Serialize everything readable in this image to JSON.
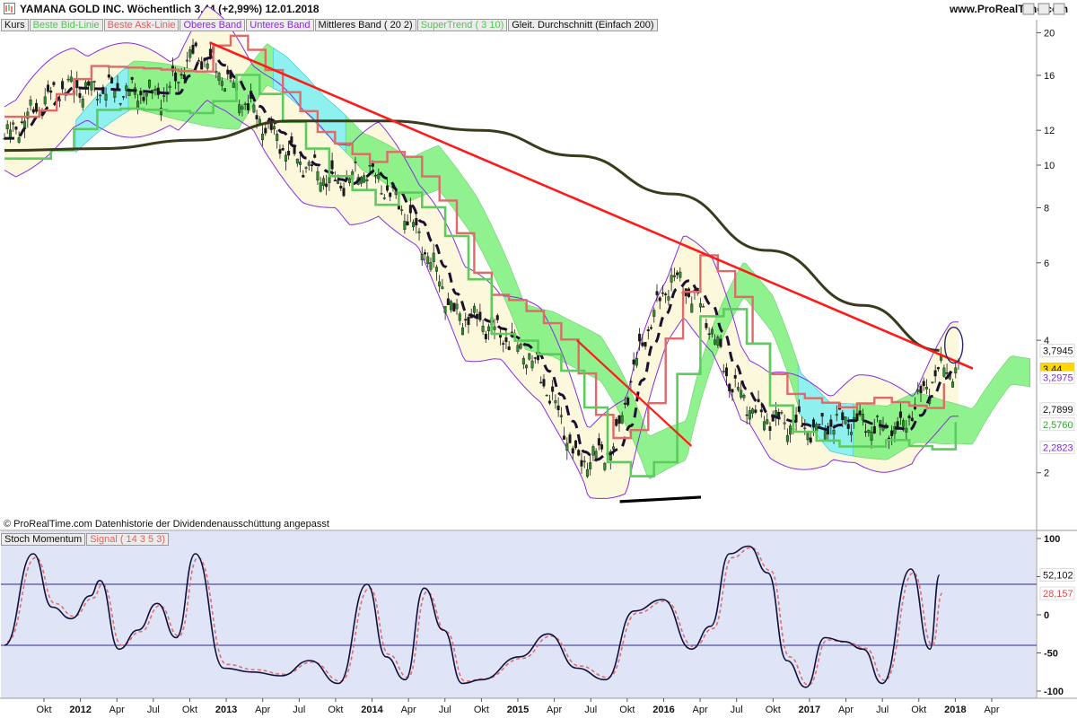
{
  "header": {
    "title": "YAMANA GOLD INC.   Wöchentlich   3,44 (+2,99%)   12.01.2018",
    "site": "www.ProRealTime.com"
  },
  "legend": [
    {
      "label": "Kurs",
      "color": "#111111"
    },
    {
      "label": "Beste Bid-Linie",
      "color": "#55c455"
    },
    {
      "label": "Beste Ask-Linie",
      "color": "#e06060"
    },
    {
      "label": "Oberes Band",
      "color": "#8a2be2"
    },
    {
      "label": "Unteres Band",
      "color": "#8a2be2"
    },
    {
      "label": "Mittleres Band ( 20 2)",
      "color": "#111111"
    },
    {
      "label": "SuperTrend ( 3 10)",
      "color": "#55c455"
    },
    {
      "label": "Gleit. Durchschnitt (Einfach 200)",
      "color": "#111111"
    }
  ],
  "footer": {
    "copyright": "© ProRealTime.com  Datenhistorie der Dividendenausschüttung angepasst"
  },
  "indicator": {
    "name": "Stoch Momentum",
    "signal": "Signal ( 14 3 5 3)"
  },
  "colors": {
    "trendline": "#ff1a1a",
    "sma200": "#3a3a1c",
    "bollinger": "#8a2be2",
    "ask": "#e06a6a",
    "supertrend": "#5ccc5c",
    "cloud_green": "#7cf07c",
    "cloud_cyan": "#8ff0f0"
  },
  "chart_data": [
    {
      "type": "line",
      "y_scale": "log",
      "ylim": [
        1.5,
        21
      ],
      "y_ticks": [
        2,
        4,
        6,
        8,
        10,
        12,
        16,
        20
      ],
      "x_tick_labels": [
        "Okt",
        "2012",
        "Apr",
        "Jul",
        "Okt",
        "2013",
        "Apr",
        "Jul",
        "Okt",
        "2014",
        "Apr",
        "Jul",
        "Okt",
        "2015",
        "Apr",
        "Jul",
        "Okt",
        "2016",
        "Apr",
        "Jul",
        "Okt",
        "2017",
        "Apr",
        "Jul",
        "Okt",
        "2018",
        "Apr"
      ],
      "last_values": [
        {
          "label": "3,7945",
          "name": "SMA 200",
          "y": 3.7945,
          "color": "#ffffff",
          "text": "#111111"
        },
        {
          "label": "3,44",
          "name": "Kurs",
          "y": 3.44,
          "color": "#ffd700",
          "text": "#111111"
        },
        {
          "label": "3,2975",
          "name": "Oberes Band",
          "y": 3.2975,
          "color": "#ffffff",
          "text": "#7a2be2"
        },
        {
          "label": "2,7899",
          "name": "Mittleres Band",
          "y": 2.7899,
          "color": "#ffffff",
          "text": "#111111"
        },
        {
          "label": "2,5760",
          "name": "SuperTrend",
          "y": 2.576,
          "color": "#ffffff",
          "text": "#3aa03a"
        },
        {
          "label": "2,2823",
          "name": "Unteres Band",
          "y": 2.2823,
          "color": "#ffffff",
          "text": "#7a2be2"
        }
      ],
      "series": [
        {
          "name": "Kurs",
          "x": [
            0,
            0.06,
            0.12,
            0.17,
            0.2,
            0.22,
            0.26,
            0.3,
            0.35,
            0.38,
            0.42,
            0.47,
            0.5,
            0.55,
            0.6,
            0.64,
            0.67,
            0.7,
            0.73,
            0.76,
            0.79,
            0.82,
            0.85,
            0.88,
            0.91,
            0.94,
            0.98
          ],
          "y": [
            11.5,
            15.0,
            14.8,
            14.5,
            18.0,
            16.8,
            13.2,
            10.5,
            9.0,
            9.8,
            7.8,
            4.6,
            4.4,
            3.7,
            2.1,
            2.3,
            4.0,
            5.6,
            4.8,
            3.2,
            2.7,
            2.6,
            2.5,
            2.65,
            2.55,
            2.5,
            3.44
          ]
        },
        {
          "name": "Gleit. Durchschnitt (Einfach 200)",
          "x": [
            0,
            0.1,
            0.2,
            0.3,
            0.4,
            0.5,
            0.6,
            0.7,
            0.8,
            0.9,
            0.98
          ],
          "y": [
            10.8,
            10.9,
            11.4,
            12.6,
            12.6,
            12.0,
            10.5,
            8.6,
            6.4,
            4.8,
            3.7945
          ]
        }
      ]
    },
    {
      "type": "line",
      "title": "Stoch Momentum",
      "ylim": [
        -100,
        100
      ],
      "y_ticks": [
        100,
        50,
        0,
        -50,
        -100
      ],
      "reference_lines": [
        40,
        -40
      ],
      "last_values": [
        {
          "label": "52,102",
          "name": "Stoch Momentum",
          "y": 52.102
        },
        {
          "label": "28,157",
          "name": "Signal",
          "y": 28.157
        }
      ],
      "series": [
        {
          "name": "Stoch Momentum",
          "x": [
            0,
            0.03,
            0.05,
            0.07,
            0.09,
            0.1,
            0.12,
            0.14,
            0.16,
            0.18,
            0.2,
            0.23,
            0.26,
            0.29,
            0.32,
            0.35,
            0.38,
            0.4,
            0.42,
            0.44,
            0.46,
            0.48,
            0.5,
            0.54,
            0.57,
            0.6,
            0.63,
            0.66,
            0.69,
            0.72,
            0.74,
            0.76,
            0.78,
            0.8,
            0.82,
            0.84,
            0.86,
            0.88,
            0.9,
            0.92,
            0.95,
            0.97,
            0.98
          ],
          "y": [
            -40,
            80,
            10,
            -5,
            25,
            45,
            -45,
            -20,
            15,
            -30,
            80,
            -70,
            -75,
            -80,
            -60,
            -90,
            40,
            -55,
            -85,
            35,
            -20,
            -90,
            -85,
            -55,
            -25,
            -70,
            -85,
            5,
            20,
            -45,
            -15,
            80,
            90,
            55,
            -60,
            -95,
            -30,
            -35,
            -45,
            -90,
            60,
            -45,
            52.102
          ]
        },
        {
          "name": "Signal",
          "x": [
            0,
            0.03,
            0.05,
            0.07,
            0.09,
            0.1,
            0.12,
            0.14,
            0.16,
            0.18,
            0.2,
            0.23,
            0.26,
            0.29,
            0.32,
            0.35,
            0.38,
            0.4,
            0.42,
            0.44,
            0.46,
            0.48,
            0.5,
            0.54,
            0.57,
            0.6,
            0.63,
            0.66,
            0.69,
            0.72,
            0.74,
            0.76,
            0.78,
            0.8,
            0.82,
            0.84,
            0.86,
            0.88,
            0.9,
            0.92,
            0.95,
            0.97,
            0.98
          ],
          "y": [
            -35,
            75,
            15,
            -2,
            22,
            40,
            -40,
            -22,
            12,
            -28,
            75,
            -65,
            -72,
            -78,
            -62,
            -87,
            35,
            -52,
            -82,
            30,
            -22,
            -87,
            -84,
            -57,
            -28,
            -67,
            -82,
            2,
            18,
            -42,
            -18,
            75,
            88,
            58,
            -55,
            -92,
            -33,
            -36,
            -44,
            -86,
            55,
            -40,
            28.157
          ]
        }
      ]
    }
  ]
}
